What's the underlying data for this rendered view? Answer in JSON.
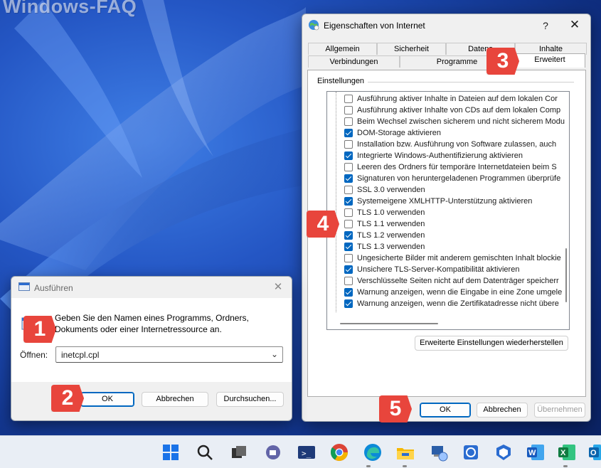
{
  "watermark": "Windows-FAQ",
  "inet": {
    "title": "Eigenschaften von Internet",
    "help": "?",
    "close": "✕",
    "tabs_row1": [
      "Allgemein",
      "Sicherheit",
      "Datens",
      "Inhalte"
    ],
    "tabs_row2": [
      "Verbindungen",
      "Programme",
      "Erweitert"
    ],
    "group_label": "Einstellungen",
    "settings": [
      {
        "label": "Ausführung aktiver Inhalte in Dateien auf dem lokalen Cor",
        "checked": false
      },
      {
        "label": "Ausführung aktiver Inhalte von CDs auf dem lokalen Comp",
        "checked": false
      },
      {
        "label": "Beim Wechsel zwischen sicherem und nicht sicherem Modu",
        "checked": false
      },
      {
        "label": "DOM-Storage aktivieren",
        "checked": true
      },
      {
        "label": "Installation bzw. Ausführung von Software zulassen, auch",
        "checked": false
      },
      {
        "label": "Integrierte Windows-Authentifizierung aktivieren",
        "checked": true
      },
      {
        "label": "Leeren des Ordners für temporäre Internetdateien beim S",
        "checked": false
      },
      {
        "label": "Signaturen von heruntergeladenen Programmen überprüfe",
        "checked": true
      },
      {
        "label": "SSL 3.0 verwenden",
        "checked": false
      },
      {
        "label": "Systemeigene XMLHTTP-Unterstützung aktivieren",
        "checked": true
      },
      {
        "label": "TLS 1.0 verwenden",
        "checked": false
      },
      {
        "label": "TLS 1.1 verwenden",
        "checked": false
      },
      {
        "label": "TLS 1.2 verwenden",
        "checked": true
      },
      {
        "label": "TLS 1.3 verwenden",
        "checked": true
      },
      {
        "label": "Ungesicherte Bilder mit anderem gemischten Inhalt blockie",
        "checked": false
      },
      {
        "label": "Unsichere TLS-Server-Kompatibilität aktivieren",
        "checked": true
      },
      {
        "label": "Verschlüsselte Seiten nicht auf dem Datenträger speicherr",
        "checked": false
      },
      {
        "label": "Warnung anzeigen, wenn die Eingabe in eine Zone umgele",
        "checked": true
      },
      {
        "label": "Warnung anzeigen, wenn die Zertifikatadresse nicht übere",
        "checked": true
      }
    ],
    "restore_button": "Erweiterte Einstellungen wiederherstellen",
    "ok": "OK",
    "cancel": "Abbrechen",
    "apply": "Übernehmen"
  },
  "run": {
    "title": "Ausführen",
    "close": "✕",
    "description": "Geben Sie den Namen eines Programms, Ordners, Dokuments oder einer Internetressource an.",
    "open_label": "Öffnen:",
    "open_value": "inetcpl.cpl",
    "ok": "OK",
    "cancel": "Abbrechen",
    "browse": "Durchsuchen..."
  },
  "badges": [
    "1",
    "2",
    "3",
    "4",
    "5"
  ],
  "taskbar_icons": [
    "windows-start-icon",
    "search-icon",
    "task-view-icon",
    "teams-chat-icon",
    "terminal-icon",
    "chrome-icon",
    "edge-icon",
    "file-explorer-icon",
    "network-settings-icon",
    "internet-options-icon",
    "security-center-icon",
    "word-icon",
    "excel-icon",
    "outlook-icon"
  ]
}
